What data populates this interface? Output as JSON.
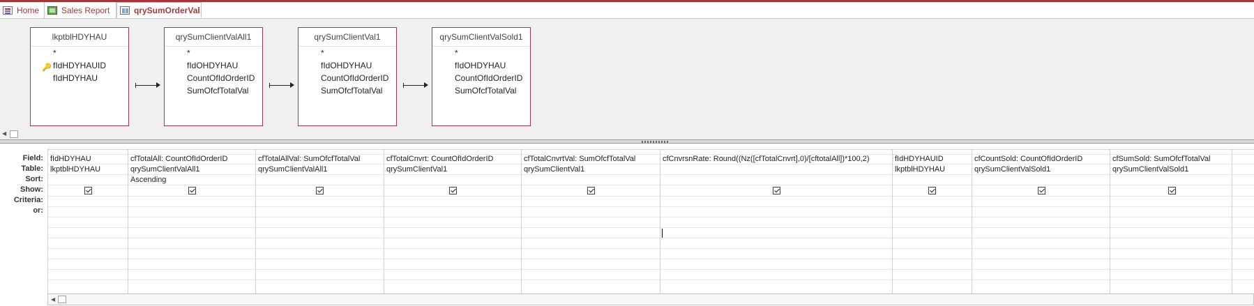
{
  "tabs": [
    {
      "label": "Home",
      "icon": "form-icon"
    },
    {
      "label": "Sales Report",
      "icon": "report-icon"
    },
    {
      "label": "qrySumOrderVal",
      "icon": "query-icon",
      "active": true
    }
  ],
  "tables": [
    {
      "title": "lkptblHDYHAU",
      "fields": [
        "*",
        "fIdHDYHAUID",
        "fIdHDYHAU"
      ],
      "key_field": "fIdHDYHAUID"
    },
    {
      "title": "qrySumClientValAll1",
      "fields": [
        "*",
        "fIdOHDYHAU",
        "CountOfIdOrderID",
        "SumOfcfTotalVal"
      ]
    },
    {
      "title": "qrySumClientVal1",
      "fields": [
        "*",
        "fIdOHDYHAU",
        "CountOfIdOrderID",
        "SumOfcfTotalVal"
      ]
    },
    {
      "title": "qrySumClientValSold1",
      "fields": [
        "*",
        "fIdOHDYHAU",
        "CountOfIdOrderID",
        "SumOfcfTotalVal"
      ]
    }
  ],
  "row_labels": [
    "Field:",
    "Table:",
    "Sort:",
    "Show:",
    "Criteria:",
    "or:"
  ],
  "columns": [
    {
      "field": "fIdHDYHAU",
      "table": "lkptblHDYHAU",
      "sort": "",
      "show": true
    },
    {
      "field": "cfTotalAll: CountOfIdOrderID",
      "table": "qrySumClientValAll1",
      "sort": "Ascending",
      "show": true
    },
    {
      "field": "cfTotalAllVal: SumOfcfTotalVal",
      "table": "qrySumClientValAll1",
      "sort": "",
      "show": true
    },
    {
      "field": "cfTotalCnvrt: CountOfIdOrderID",
      "table": "qrySumClientVal1",
      "sort": "",
      "show": true
    },
    {
      "field": "cfTotalCnvrtVal: SumOfcfTotalVal",
      "table": "qrySumClientVal1",
      "sort": "",
      "show": true
    },
    {
      "field": "cfCnvrsnRate: Round((Nz([cfTotalCnvrt],0)/[cftotalAll])*100,2)",
      "table": "",
      "sort": "",
      "show": true
    },
    {
      "field": "fIdHDYHAUID",
      "table": "lkptblHDYHAU",
      "sort": "",
      "show": true
    },
    {
      "field": "cfCountSold: CountOfIdOrderID",
      "table": "qrySumClientValSold1",
      "sort": "",
      "show": true
    },
    {
      "field": "cfSumSold: SumOfcfTotalVal",
      "table": "qrySumClientValSold1",
      "sort": "",
      "show": true
    }
  ],
  "colors": {
    "accent": "#a4373a",
    "designer_bg": "#f0f0f0"
  }
}
